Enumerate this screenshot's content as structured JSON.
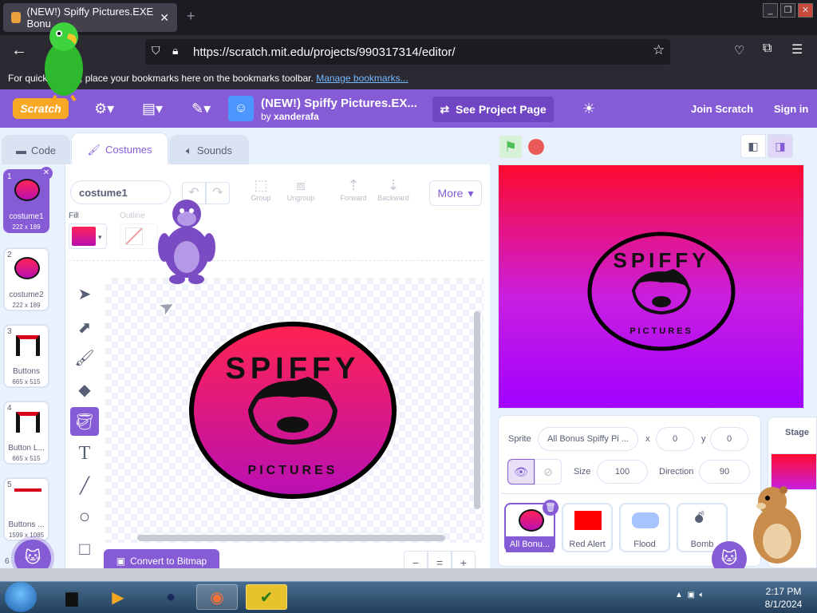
{
  "browser": {
    "tab_title": "(NEW!) Spiffy Pictures.EXE Bonu",
    "tab_close": "✕",
    "new_tab": "+",
    "url": "https://scratch.mit.edu/projects/990317314/editor/",
    "bookmarks_text": "For quick access, place your bookmarks here on the bookmarks toolbar.",
    "bookmarks_link": "Manage bookmarks..."
  },
  "menubar": {
    "logo": "Scratch",
    "project_title": "(NEW!) Spiffy Pictures.EX...",
    "by": "by",
    "author": "xanderafa",
    "see_project": "See Project Page",
    "join": "Join Scratch",
    "sign_in": "Sign in"
  },
  "tabs": {
    "code": "Code",
    "costumes": "Costumes",
    "sounds": "Sounds"
  },
  "costumes": [
    {
      "num": "1",
      "name": "costume1",
      "size": "222 x 189"
    },
    {
      "num": "2",
      "name": "costume2",
      "size": "222 x 189"
    },
    {
      "num": "3",
      "name": "Buttons",
      "size": "665 x 515"
    },
    {
      "num": "4",
      "name": "Button L...",
      "size": "665 x 515"
    },
    {
      "num": "5",
      "name": "Buttons ...",
      "size": "1599 x 1085"
    },
    {
      "num": "6"
    }
  ],
  "paint": {
    "costume_name": "costume1",
    "group": "Group",
    "ungroup": "Ungroup",
    "forward": "Forward",
    "backward": "Backward",
    "more": "More",
    "fill_label": "Fill",
    "outline_label": "Outline",
    "convert": "Convert to Bitmap",
    "zoom_out": "−",
    "zoom_reset": "=",
    "zoom_in": "+"
  },
  "artwork": {
    "top_text": "SPIFFY",
    "bottom_text": "PICTURES"
  },
  "sprite_info": {
    "sprite_label": "Sprite",
    "sprite_name": "All Bonus Spiffy Pi ...",
    "x_label": "x",
    "x": "0",
    "y_label": "y",
    "y": "0",
    "size_label": "Size",
    "size": "100",
    "direction_label": "Direction",
    "direction": "90",
    "stage_label": "Stage"
  },
  "sprites": [
    {
      "name": "All Bonu..."
    },
    {
      "name": "Red Alert"
    },
    {
      "name": "Flood"
    },
    {
      "name": "Bomb"
    }
  ],
  "taskbar": {
    "time": "2:17 PM",
    "date": "8/1/2024"
  },
  "colors": {
    "scratch_purple": "#855cd6",
    "fill_top": "#ff2258",
    "fill_bottom": "#b70fb0"
  }
}
